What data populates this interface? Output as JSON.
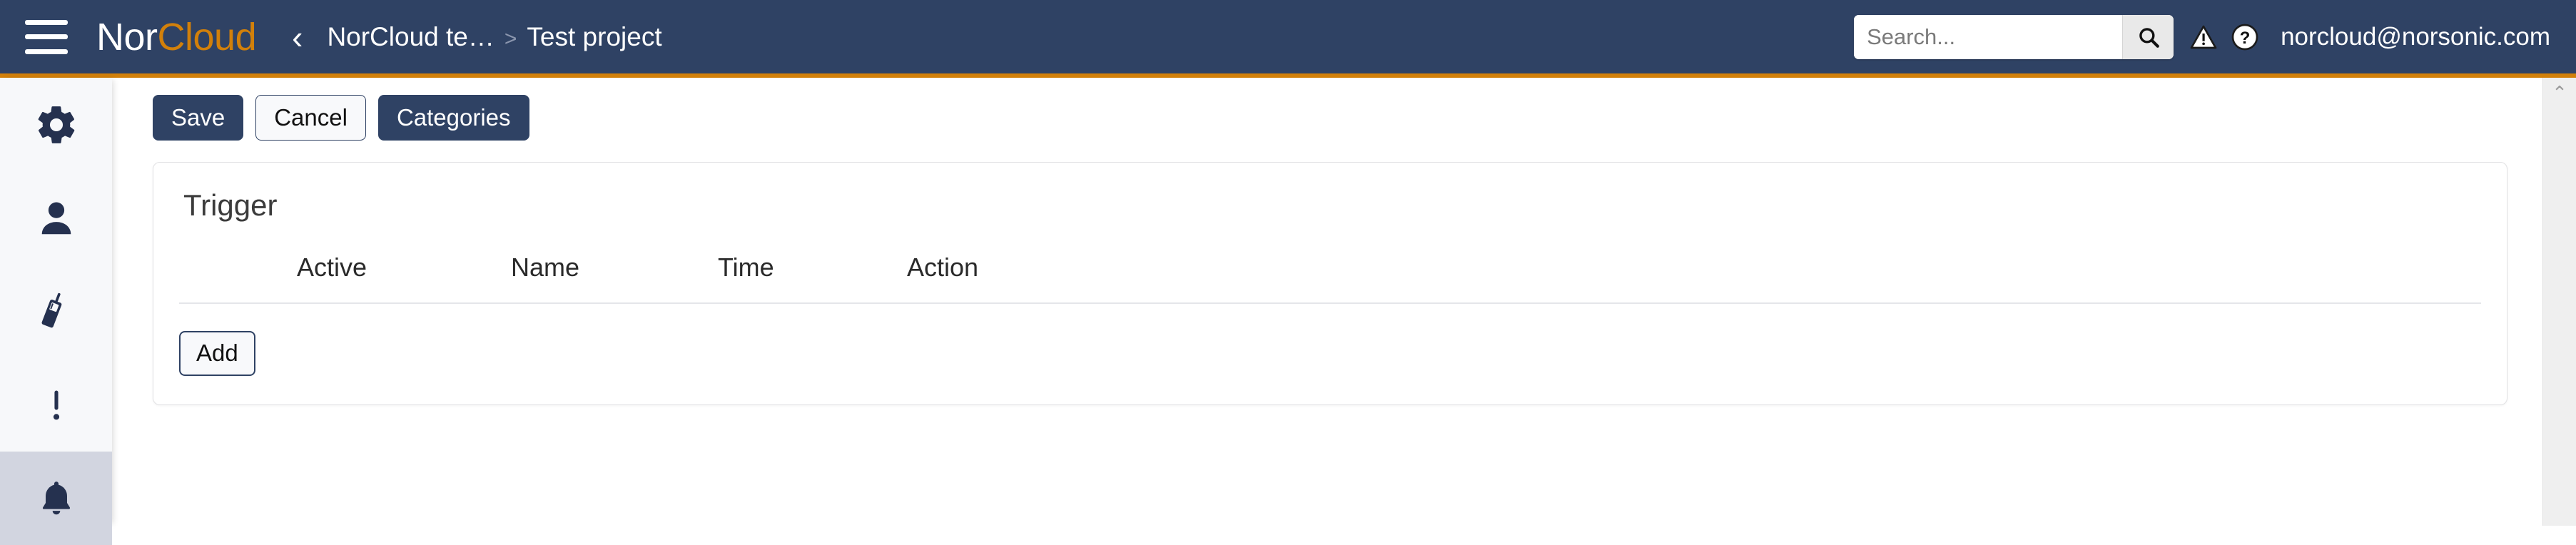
{
  "header": {
    "menu_label": "menu",
    "brand_first": "Nor",
    "brand_second": "Cloud",
    "back_chevron": "‹",
    "breadcrumb": {
      "items": [
        "NorCloud te…",
        "Test project"
      ],
      "separator": ">"
    },
    "search": {
      "placeholder": "Search...",
      "value": "",
      "button_label": "search"
    },
    "warning_label": "!",
    "help_label": "?",
    "user_email": "norcloud@norsonic.com",
    "colors": {
      "bar": "#2f4264",
      "accent": "#d2800a",
      "brand_accent": "#d2800a"
    }
  },
  "sidebar": {
    "items": [
      {
        "name": "settings",
        "icon": "gear-icon",
        "active": false
      },
      {
        "name": "user",
        "icon": "person-icon",
        "active": false
      },
      {
        "name": "instrument",
        "icon": "sound-level-meter-icon",
        "active": false
      },
      {
        "name": "alerts",
        "icon": "exclamation-icon",
        "active": false
      },
      {
        "name": "notifications",
        "icon": "bell-icon",
        "active": true
      }
    ]
  },
  "toolbar": {
    "save_label": "Save",
    "cancel_label": "Cancel",
    "categories_label": "Categories"
  },
  "card": {
    "title": "Trigger",
    "columns": [
      "Active",
      "Name",
      "Time",
      "Action"
    ],
    "rows": [],
    "add_label": "Add"
  },
  "scrollbar": {
    "up_arrow": "⌃"
  }
}
